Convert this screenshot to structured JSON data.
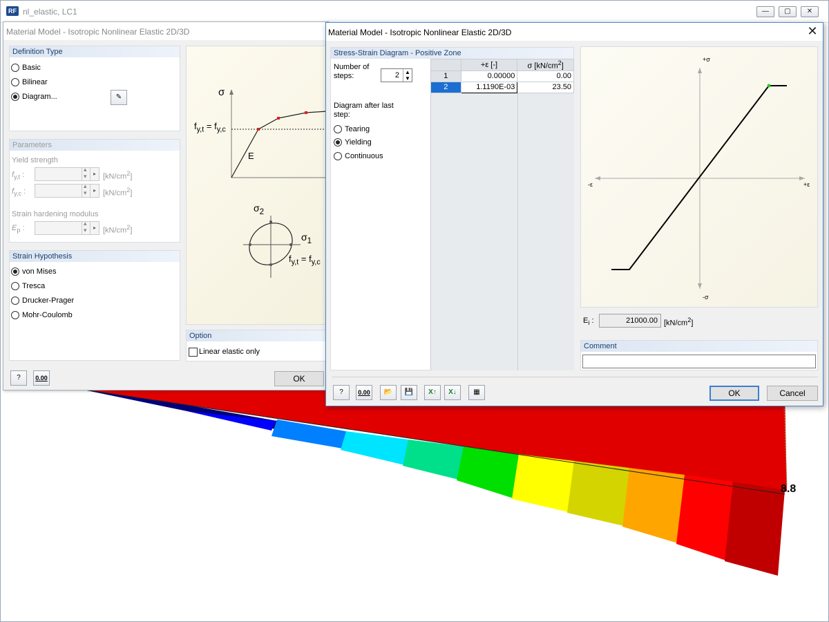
{
  "app": {
    "title": "nl_elastic, LC1",
    "logo": "RF",
    "min_icon": "minimize-icon",
    "max_icon": "maximize-icon",
    "close_icon": "close-icon",
    "value_label": "8.8",
    "colors": [
      "#00007a",
      "#0000ff",
      "#0080ff",
      "#00e5ff",
      "#00e08a",
      "#00e000",
      "#ffff00",
      "#d4d400",
      "#ffa500",
      "#ff0000",
      "#c00000"
    ]
  },
  "dlg1": {
    "title": "Material Model - Isotropic Nonlinear Elastic 2D/3D",
    "definition_type": {
      "title": "Definition Type",
      "options": [
        "Basic",
        "Bilinear",
        "Diagram..."
      ],
      "selected": 2,
      "edit_icon": "edit-diagram-icon"
    },
    "parameters": {
      "title": "Parameters",
      "yield_strength": "Yield strength",
      "fyt_label": "f",
      "fyt_sub": "y,t",
      "fyc_label": "f",
      "fyc_sub": "y,c",
      "unit": "[kN/cm",
      "unit_sup": "2",
      "unit_end": "]",
      "hardening": "Strain hardening modulus",
      "ep_label": "E",
      "ep_sub": "p"
    },
    "strain_hypothesis": {
      "title": "Strain Hypothesis",
      "options": [
        "von Mises",
        "Tresca",
        "Drucker-Prager",
        "Mohr-Coulomb"
      ],
      "selected": 0
    },
    "illustration": {
      "sigma": "σ",
      "fy_eq": "f",
      "fy_sub1": "y,t",
      "fy_mid": " = f",
      "fy_sub2": "y,c",
      "e_label": "E",
      "sigma2": "σ",
      "sigma2_sub": "2",
      "sigma1": "σ",
      "sigma1_sub": "1",
      "fy2_eq": "f",
      "fy2_sub1": "y,t",
      "fy2_mid": " = f",
      "fy2_sub2": "y,c"
    },
    "option": {
      "title": "Option",
      "linear_elastic": "Linear elastic only"
    },
    "help_icon": "help-icon",
    "units_icon": "units-icon",
    "units_text": "0.00",
    "ok": "OK"
  },
  "dlg2": {
    "title": "Material Model - Isotropic Nonlinear Elastic 2D/3D",
    "close_glyph": "✕",
    "section_title": "Stress-Strain Diagram - Positive Zone",
    "steps_label_1": "Number of",
    "steps_label_2": "steps:",
    "steps_value": "2",
    "after_label_1": "Diagram after last",
    "after_label_2": "step:",
    "after_options": [
      "Tearing",
      "Yielding",
      "Continuous"
    ],
    "after_selected": 1,
    "table": {
      "col_eps": "+ε [-]",
      "col_sigma_a": "σ [kN/cm",
      "col_sigma_sup": "2",
      "col_sigma_b": "]",
      "rows": [
        {
          "n": "1",
          "eps": "0.00000",
          "sigma": "0.00"
        },
        {
          "n": "2",
          "eps": "1.1190E-03",
          "sigma": "23.50"
        }
      ]
    },
    "diagram": {
      "plus_sigma": "+σ",
      "minus_sigma": "-σ",
      "minus_eps": "-ε",
      "plus_eps": "+ε"
    },
    "ei_label": "E",
    "ei_sub": "i",
    "ei_colon": " :",
    "ei_value": "21000.00",
    "ei_unit": "[kN/cm",
    "ei_unit_sup": "2",
    "ei_unit_end": "]",
    "comment_title": "Comment",
    "comment_value": "",
    "icons": [
      "help-icon",
      "units-icon",
      "open-icon",
      "save-icon",
      "export-excel-icon",
      "import-excel-icon",
      "table-icon"
    ],
    "units_text": "0.00",
    "ok": "OK",
    "cancel": "Cancel"
  }
}
